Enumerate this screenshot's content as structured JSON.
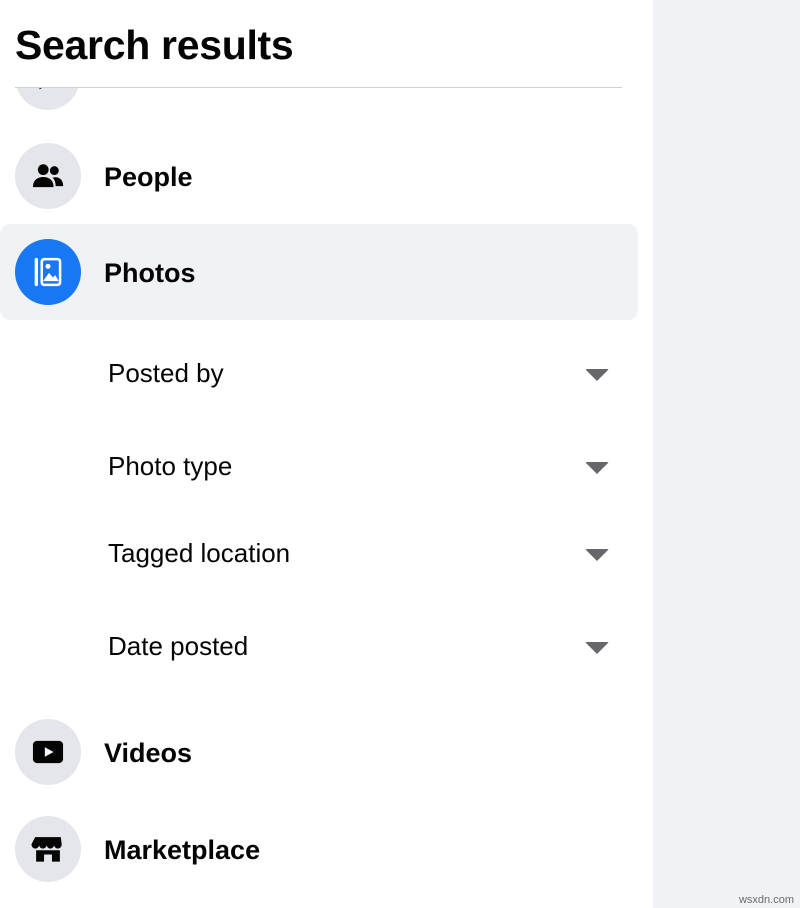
{
  "header": {
    "title": "Search results"
  },
  "nav": {
    "people": {
      "label": "People",
      "icon": "people-icon"
    },
    "photos": {
      "label": "Photos",
      "icon": "photos-icon",
      "active": true
    },
    "videos": {
      "label": "Videos",
      "icon": "video-play-icon"
    },
    "marketplace": {
      "label": "Marketplace",
      "icon": "storefront-icon"
    }
  },
  "filters": [
    {
      "label": "Posted by"
    },
    {
      "label": "Photo type"
    },
    {
      "label": "Tagged location"
    },
    {
      "label": "Date posted"
    }
  ],
  "colors": {
    "accent": "#1877f2",
    "icon_bg": "#e4e6eb",
    "active_bg": "#f0f2f5",
    "caret": "#65676b"
  },
  "watermark": "wsxdn.com"
}
